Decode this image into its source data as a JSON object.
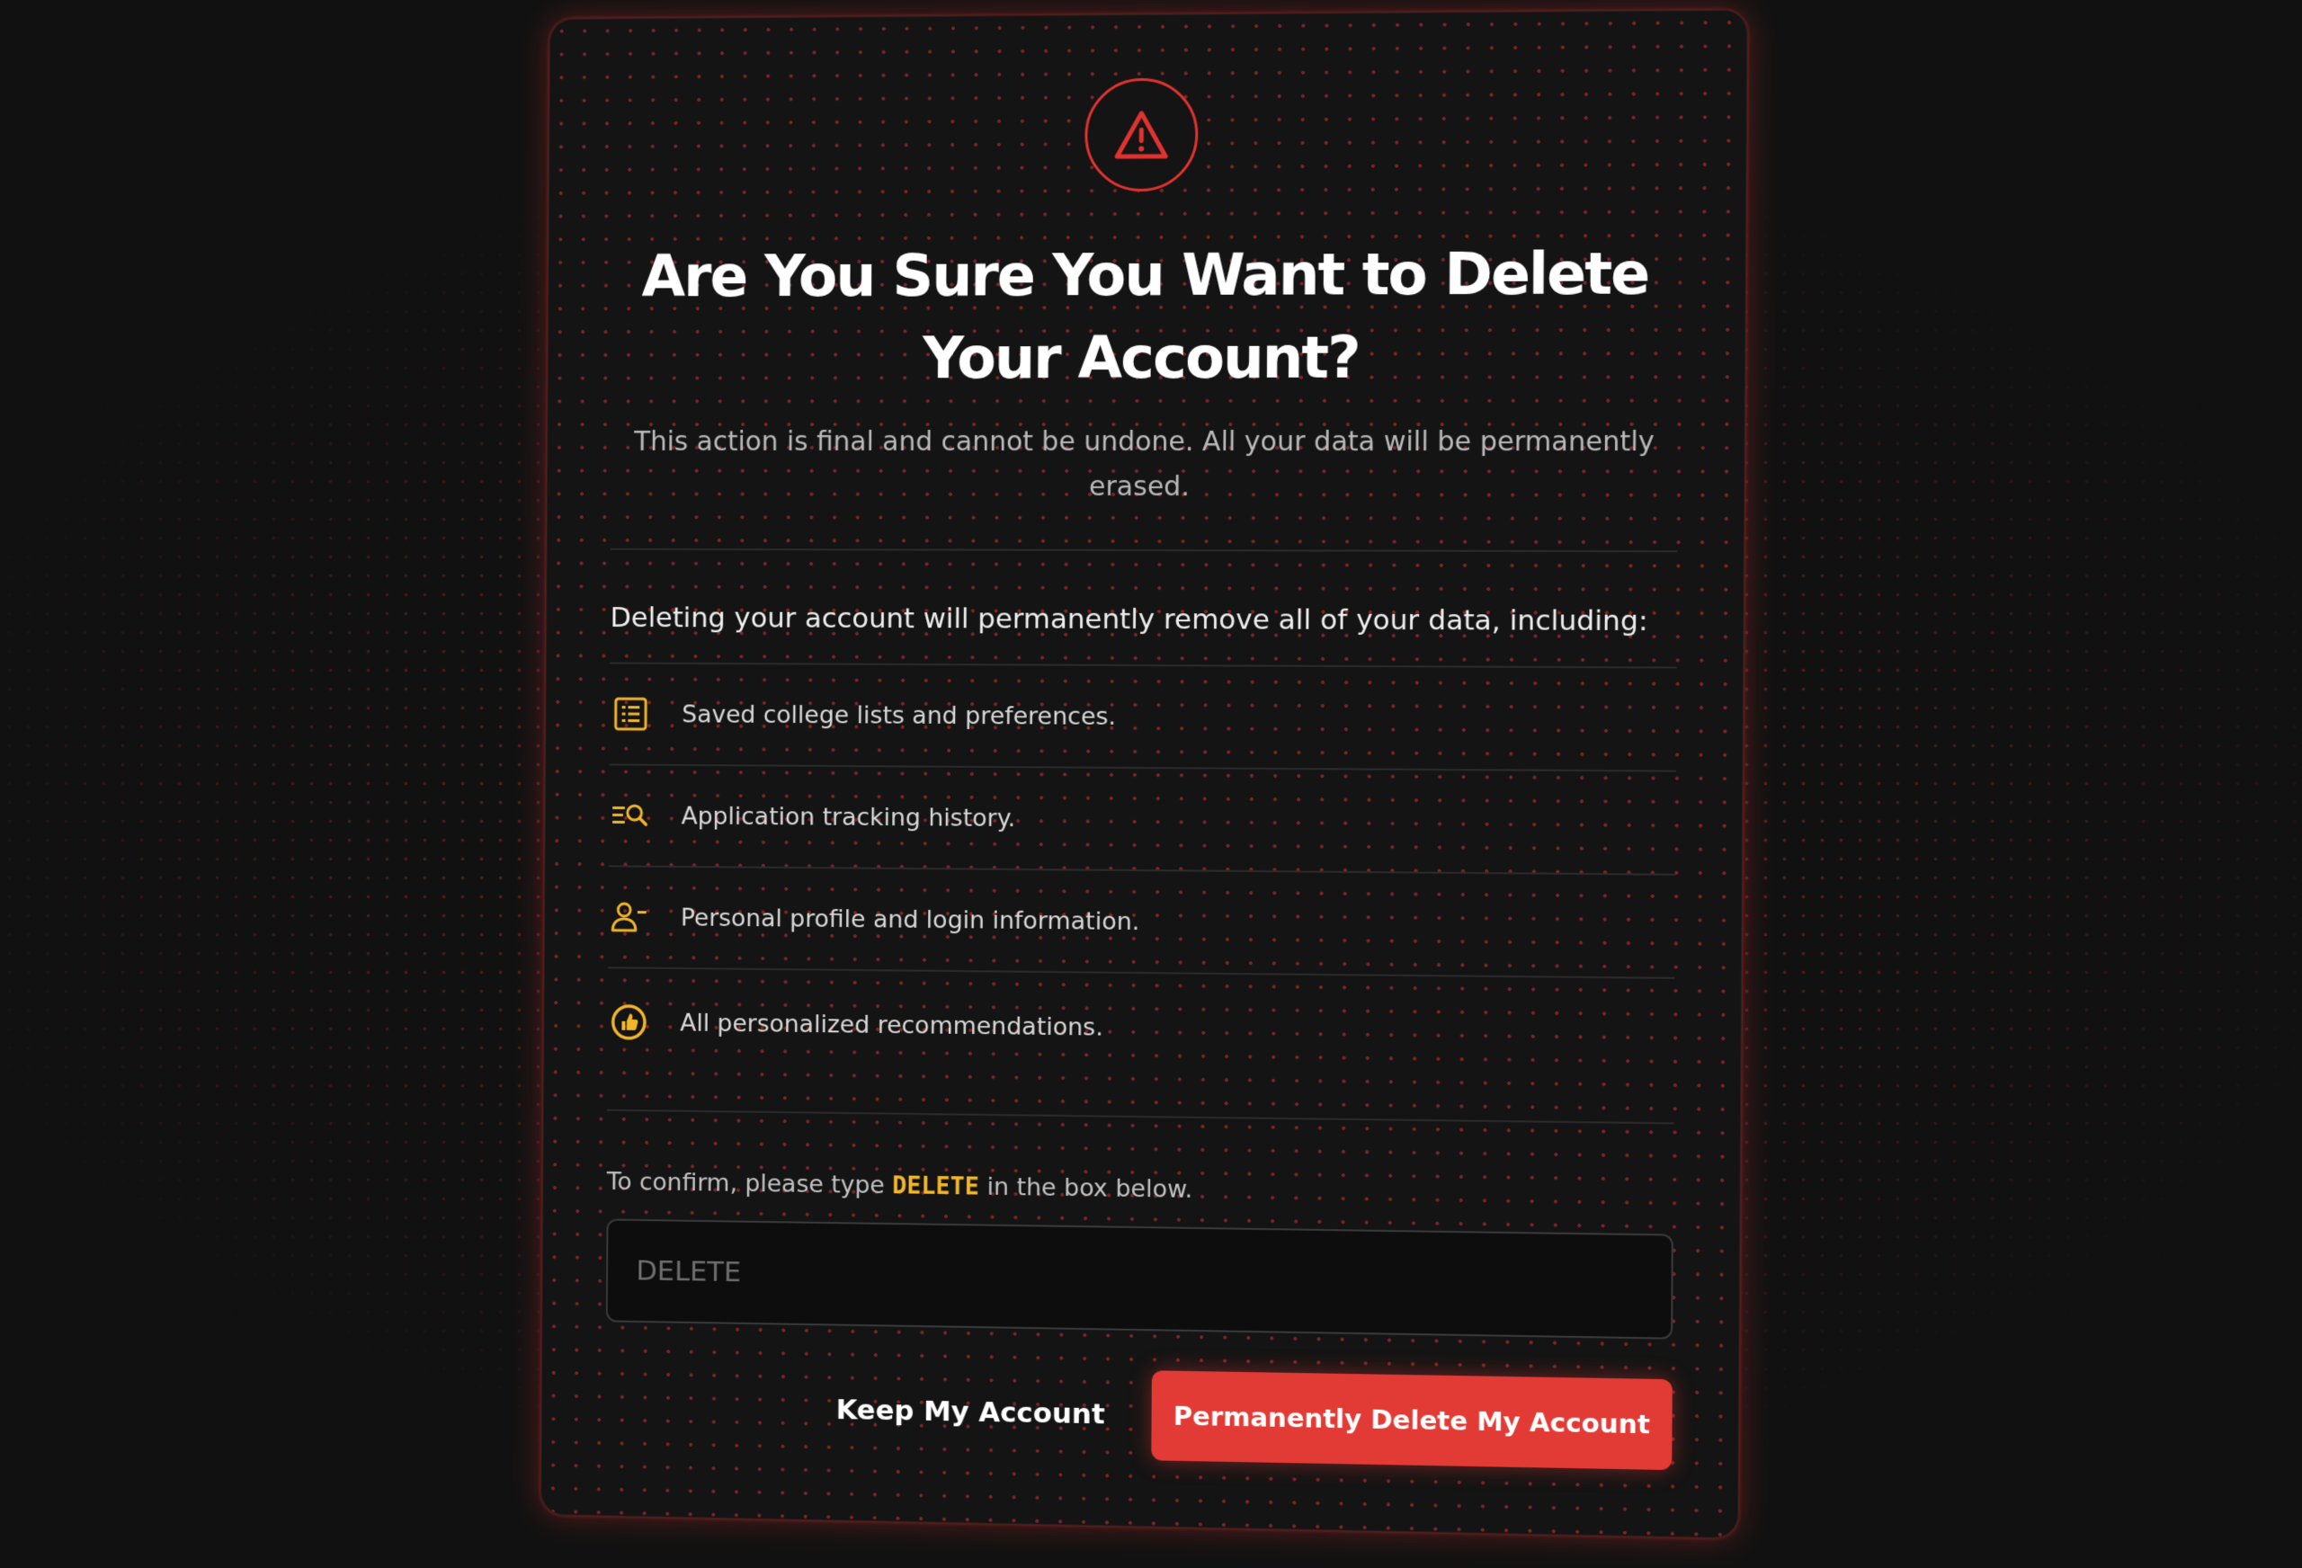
{
  "dialog": {
    "title": "Are You Sure You Want to Delete Your Account?",
    "subtitle": "This action is final and cannot be undone. All your data will be permanently erased.",
    "intro": "Deleting your account will permanently remove all of your data, including:",
    "items": [
      {
        "icon": "list-icon",
        "label": "Saved college lists and preferences."
      },
      {
        "icon": "search-list-icon",
        "label": "Application tracking history."
      },
      {
        "icon": "user-minus-icon",
        "label": "Personal profile and login information."
      },
      {
        "icon": "thumbs-up-icon",
        "label": "All personalized recommendations."
      }
    ],
    "confirm": {
      "prefix": "To confirm, please type",
      "keyword": "DELETE",
      "suffix": "in the box below.",
      "input_value": "",
      "input_placeholder": "DELETE"
    },
    "buttons": {
      "keep": "Keep My Account",
      "delete": "Permanently Delete My Account"
    }
  },
  "colors": {
    "danger": "#e23a35",
    "accent_yellow": "#f2b62b",
    "background": "#111111",
    "card": "#141414"
  }
}
